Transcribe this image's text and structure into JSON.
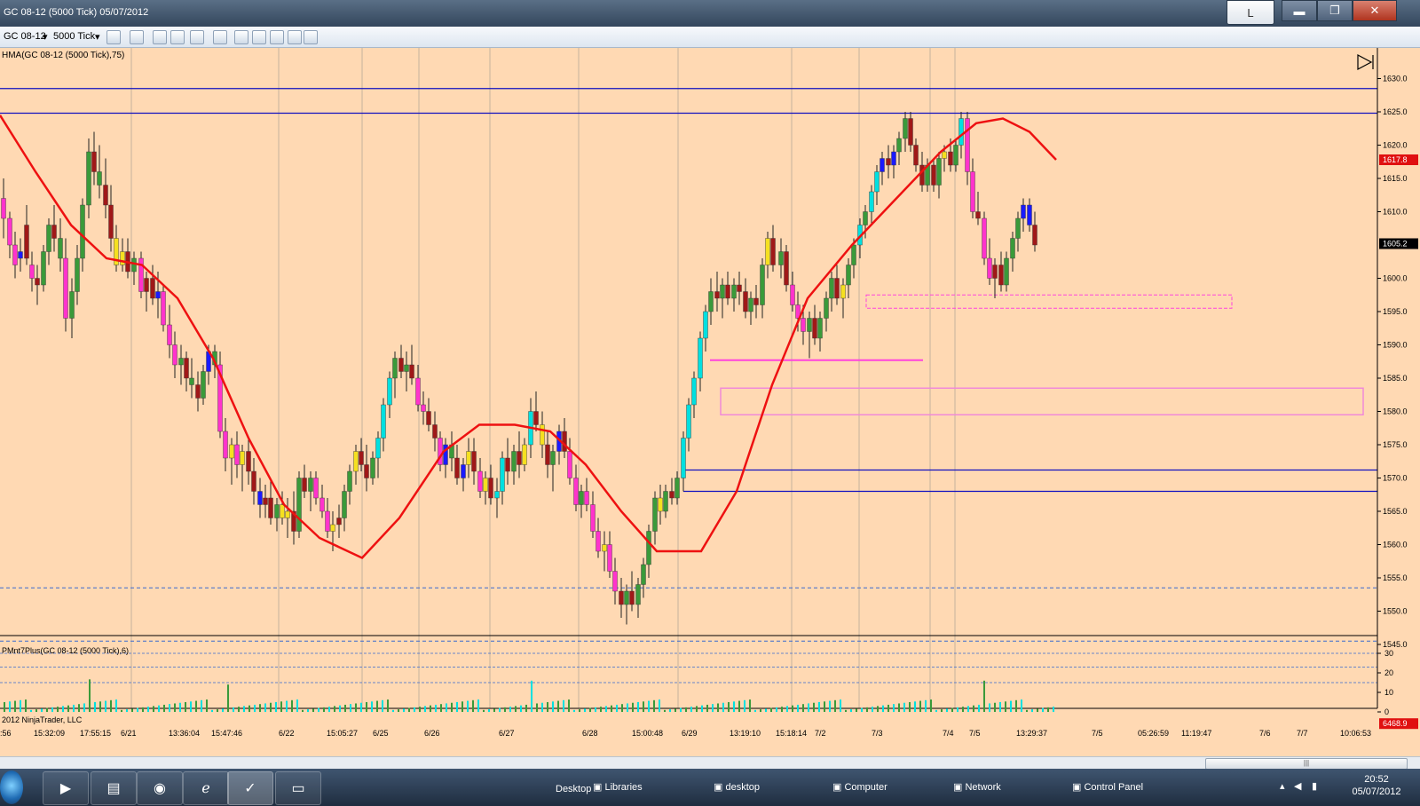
{
  "window": {
    "title": "GC 08-12 (5000 Tick)  05/07/2012",
    "btn_l": "L",
    "btn_min": "▬",
    "btn_max": "❐",
    "btn_close": "✕"
  },
  "toolbar": {
    "instrument": "GC 08-12",
    "period": "5000 Tick",
    "instrument_arrow": "▾",
    "period_arrow": "▾"
  },
  "chart": {
    "indicator_label": "HMA(GC 08-12 (5000 Tick),75)",
    "lower_label": "PMnt7Plus(GC 08-12 (5000 Tick),6)",
    "copyright": "2012 NinjaTrader, LLC",
    "last_price_label": "1605.2",
    "hma_price_label": "1617.8",
    "lower_value_label": "6468.9",
    "price_axis": [
      {
        "v": 1630,
        "t": "1630.0"
      },
      {
        "v": 1625,
        "t": "1625.0"
      },
      {
        "v": 1620,
        "t": "1620.0"
      },
      {
        "v": 1615,
        "t": "1615.0"
      },
      {
        "v": 1610,
        "t": "1610.0"
      },
      {
        "v": 1600,
        "t": "1600.0"
      },
      {
        "v": 1595,
        "t": "1595.0"
      },
      {
        "v": 1590,
        "t": "1590.0"
      },
      {
        "v": 1585,
        "t": "1585.0"
      },
      {
        "v": 1580,
        "t": "1580.0"
      },
      {
        "v": 1575,
        "t": "1575.0"
      },
      {
        "v": 1570,
        "t": "1570.0"
      },
      {
        "v": 1565,
        "t": "1565.0"
      },
      {
        "v": 1560,
        "t": "1560.0"
      },
      {
        "v": 1555,
        "t": "1555.0"
      },
      {
        "v": 1550,
        "t": "1550.0"
      },
      {
        "v": 1545,
        "t": "1545.0"
      }
    ],
    "lower_axis": [
      {
        "v": 30,
        "t": "30"
      },
      {
        "v": 20,
        "t": "20"
      },
      {
        "v": 10,
        "t": "10"
      },
      {
        "v": 0,
        "t": "0"
      }
    ],
    "time_axis": [
      ":56",
      "15:32:09",
      "17:55:15",
      "6/21",
      "13:36:04",
      "15:47:46",
      "6/22",
      "15:05:27",
      "6/25",
      "6/26",
      "6/27",
      "6/28",
      "15:00:48",
      "6/29",
      "13:19:10",
      "15:18:14",
      "7/2",
      "7/3",
      "7/4",
      "7/5",
      "13:29:37",
      "7/5",
      "05:26:59",
      "11:19:47",
      "7/6",
      "7/7",
      "10:06:53"
    ],
    "colors": {
      "background": "#ffd9b3",
      "bull": "#00e0e0",
      "bear": "#ff33cc",
      "neutral": "#f5e020",
      "blue_candle": "#1a1aff",
      "dark_candle": "#a01818",
      "green_candle": "#3a9a3a",
      "hma_down": "#ee1111",
      "hma_up": "#1a7a1a",
      "level_line": "#1010c0",
      "zone": "#ff44dd"
    }
  },
  "taskbar": {
    "desktop": "Desktop",
    "libraries": "Libraries",
    "desktop_folder": "desktop",
    "computer": "Computer",
    "network": "Network",
    "control_panel": "Control Panel",
    "time": "20:52",
    "date": "05/07/2012"
  }
}
